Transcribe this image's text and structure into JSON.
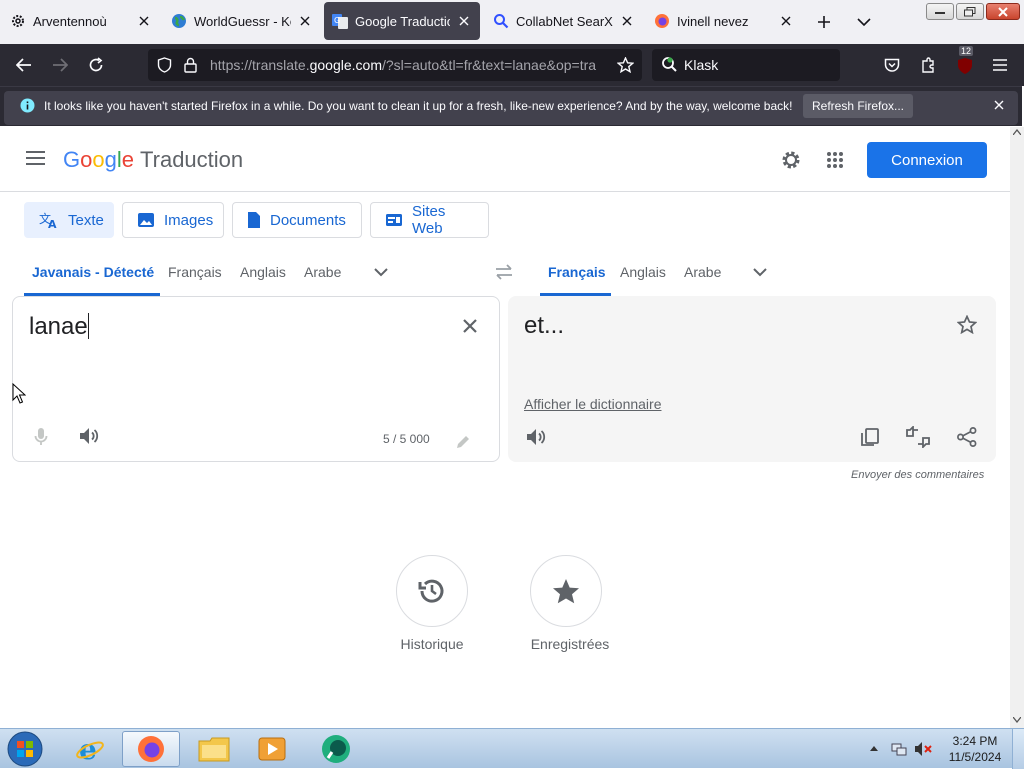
{
  "browser": {
    "tabs": [
      {
        "title": "Arventennoù",
        "icon": "gear-icon"
      },
      {
        "title": "WorldGuessr - Kost",
        "icon": "globe-icon"
      },
      {
        "title": "Google Traduction",
        "icon": "google-translate-icon"
      },
      {
        "title": "CollabNet SearXNG",
        "icon": "search-icon"
      },
      {
        "title": "Ivinell nevez",
        "icon": "firefox-icon"
      }
    ],
    "active_tab": 2,
    "url_prefix": "https://translate.",
    "url_domain": "google.com",
    "url_suffix": "/?sl=auto&tl=fr&text=lanae&op=tra",
    "search_placeholder": "Klask",
    "extension_badge": "12"
  },
  "notification": {
    "text": "It looks like you haven't started Firefox in a while. Do you want to clean it up for a fresh, like-new experience? And by the way, welcome back!",
    "button": "Refresh Firefox..."
  },
  "header": {
    "logo_letters": [
      "G",
      "o",
      "o",
      "g",
      "l",
      "e"
    ],
    "product": "Traduction",
    "signin": "Connexion"
  },
  "modes": [
    "Texte",
    "Images",
    "Documents",
    "Sites Web"
  ],
  "source_langs": [
    "Javanais - Détecté",
    "Français",
    "Anglais",
    "Arabe"
  ],
  "target_langs": [
    "Français",
    "Anglais",
    "Arabe"
  ],
  "source": {
    "text": "lanae",
    "count": "5 / 5 000"
  },
  "target": {
    "text": "et...",
    "dictionary": "Afficher le dictionnaire",
    "feedback": "Envoyer des commentaires"
  },
  "shortcuts": [
    "Historique",
    "Enregistrées"
  ],
  "clock": {
    "time": "3:24 PM",
    "date": "11/5/2024"
  },
  "colors": {
    "accent": "#1a73e8",
    "accent_text": "#1967d2",
    "tab_active": "#42414d",
    "toolbar": "#2b2a33"
  }
}
